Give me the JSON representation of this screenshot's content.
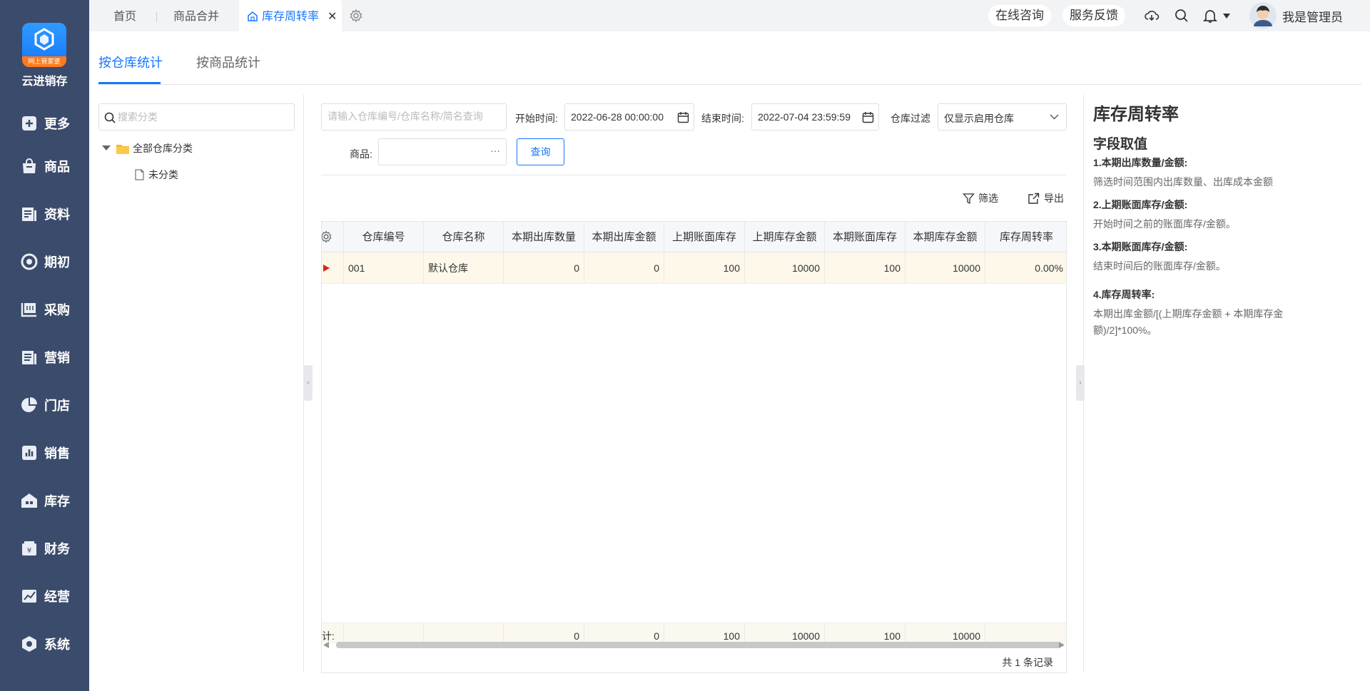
{
  "app": {
    "logo_badge": "网上管家婆",
    "name": "云进销存"
  },
  "sidebar": {
    "items": [
      {
        "label": "更多",
        "icon": "plus-square-icon"
      },
      {
        "label": "商品",
        "icon": "shopping-bag-icon"
      },
      {
        "label": "资料",
        "icon": "document-icon"
      },
      {
        "label": "期初",
        "icon": "target-icon"
      },
      {
        "label": "采购",
        "icon": "cart-icon"
      },
      {
        "label": "营销",
        "icon": "marketing-icon"
      },
      {
        "label": "门店",
        "icon": "pie-chart-icon"
      },
      {
        "label": "销售",
        "icon": "bar-chart-icon"
      },
      {
        "label": "库存",
        "icon": "warehouse-icon"
      },
      {
        "label": "财务",
        "icon": "finance-icon"
      },
      {
        "label": "经营",
        "icon": "trend-icon"
      },
      {
        "label": "系统",
        "icon": "settings-hex-icon"
      }
    ]
  },
  "tabs": [
    {
      "label": "首页"
    },
    {
      "label": "商品合并"
    },
    {
      "label": "库存周转率",
      "active": true
    }
  ],
  "topbar": {
    "online_consult": "在线咨询",
    "feedback": "服务反馈",
    "user_name": "我是管理员"
  },
  "subtabs": [
    {
      "label": "按仓库统计",
      "active": true
    },
    {
      "label": "按商品统计"
    }
  ],
  "tree": {
    "search_placeholder": "搜索分类",
    "root": "全部仓库分类",
    "child": "未分类"
  },
  "filters": {
    "keyword_placeholder": "请输入仓库编号/仓库名称/简名查询",
    "start_label": "开始时间:",
    "start_value": "2022-06-28 00:00:00",
    "end_label": "结束时间:",
    "end_value": "2022-07-04 23:59:59",
    "warehouse_label": "仓库过滤",
    "warehouse_value": "仅显示启用仓库",
    "product_label": "商品:",
    "product_ellipsis": "···",
    "query_button": "查询",
    "filter_link": "筛选",
    "export_link": "导出"
  },
  "table": {
    "columns": [
      "仓库编号",
      "仓库名称",
      "本期出库数量",
      "本期出库金额",
      "上期账面库存",
      "上期库存金额",
      "本期账面库存",
      "本期库存金额",
      "库存周转率"
    ],
    "rows": [
      [
        "001",
        "默认仓库",
        "0",
        "0",
        "100",
        "10000",
        "100",
        "10000",
        "0.00%"
      ]
    ],
    "footer_label": "合计:",
    "footer": [
      "",
      "",
      "0",
      "0",
      "100",
      "10000",
      "100",
      "10000",
      ""
    ],
    "record_count": "共 1 条记录"
  },
  "help": {
    "title": "库存周转率",
    "subtitle": "字段取值",
    "items": [
      {
        "h": "1.本期出库数量/金额:",
        "p": "筛选时间范围内出库数量、出库成本金额"
      },
      {
        "h": "2.上期账面库存/金额:",
        "p": "开始时间之前的账面库存/金额。"
      },
      {
        "h": "3.本期账面库存/金额:",
        "p": "结束时间后的账面库存/金额。"
      },
      {
        "h": "4.库存周转率:",
        "p": "本期出库金额/[(上期库存金额 + 本期库存金额)/2]*100%。"
      }
    ]
  },
  "colors": {
    "sidebar_bg": "#3b4b6b",
    "accent": "#1677ff",
    "row_highlight": "#fdf8ea"
  }
}
